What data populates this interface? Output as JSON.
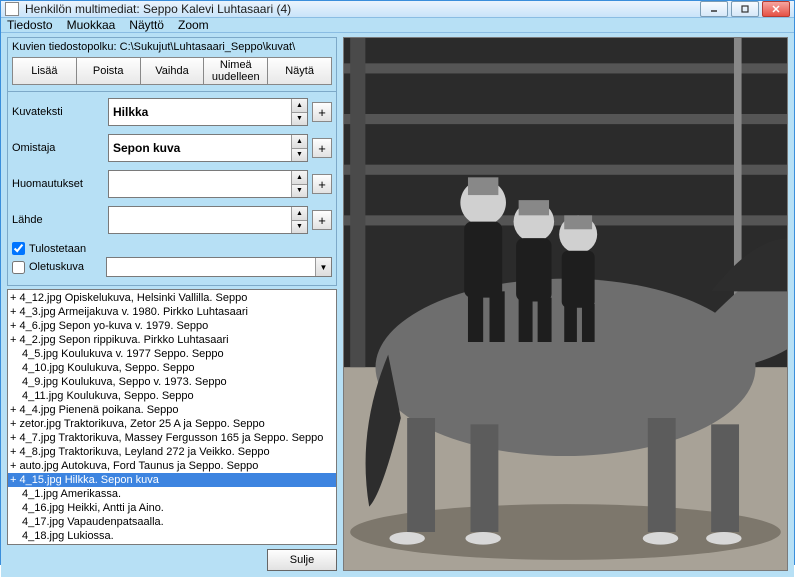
{
  "title": "Henkilön multimediat: Seppo Kalevi Luhtasaari (4)",
  "menu": {
    "tiedosto": "Tiedosto",
    "muokkaa": "Muokkaa",
    "naytto": "Näyttö",
    "zoom": "Zoom"
  },
  "pathlabel": "Kuvien tiedostopolku: C:\\Sukujut\\Luhtasaari_Seppo\\kuvat\\",
  "toolbar": {
    "lisaa": "Lisää",
    "poista": "Poista",
    "vaihda": "Vaihda",
    "nimea": "Nimeä\nuudelleen",
    "nayta": "Näytä"
  },
  "fields": {
    "kuvateksti_label": "Kuvateksti",
    "kuvateksti_value": "Hilkka",
    "omistaja_label": "Omistaja",
    "omistaja_value": "Sepon kuva",
    "huomautukset_label": "Huomautukset",
    "huomautukset_value": "",
    "lahde_label": "Lähde",
    "lahde_value": "",
    "tulostetaan": "Tulostetaan",
    "oletuskuva": "Oletuskuva"
  },
  "plus": "+",
  "files": [
    {
      "t": "+ 4_12.jpg Opiskelukuva, Helsinki Vallilla. Seppo",
      "i": false,
      "s": false
    },
    {
      "t": "+ 4_3.jpg Armeijakuva v. 1980. Pirkko Luhtasaari",
      "i": false,
      "s": false
    },
    {
      "t": "+ 4_6.jpg Sepon yo-kuva v. 1979. Seppo",
      "i": false,
      "s": false
    },
    {
      "t": "+ 4_2.jpg Sepon rippikuva. Pirkko Luhtasaari",
      "i": false,
      "s": false
    },
    {
      "t": "4_5.jpg Koulukuva v. 1977 Seppo. Seppo",
      "i": true,
      "s": false
    },
    {
      "t": "4_10.jpg Koulukuva, Seppo. Seppo",
      "i": true,
      "s": false
    },
    {
      "t": "4_9.jpg Koulukuva, Seppo v. 1973. Seppo",
      "i": true,
      "s": false
    },
    {
      "t": "4_11.jpg Koulukuva, Seppo. Seppo",
      "i": true,
      "s": false
    },
    {
      "t": "+ 4_4.jpg Pienenä poikana. Seppo",
      "i": false,
      "s": false
    },
    {
      "t": "+ zetor.jpg Traktorikuva, Zetor 25 A ja Seppo. Seppo",
      "i": false,
      "s": false
    },
    {
      "t": "+ 4_7.jpg Traktorikuva, Massey Fergusson 165 ja Seppo. Seppo",
      "i": false,
      "s": false
    },
    {
      "t": "+ 4_8.jpg Traktorikuva, Leyland 272 ja Veikko. Seppo",
      "i": false,
      "s": false
    },
    {
      "t": "+ auto.jpg Autokuva, Ford Taunus ja Seppo. Seppo",
      "i": false,
      "s": false
    },
    {
      "t": "+ 4_15.jpg Hilkka. Sepon kuva",
      "i": false,
      "s": true
    },
    {
      "t": "4_1.jpg Amerikassa.",
      "i": true,
      "s": false
    },
    {
      "t": "4_16.jpg Heikki, Antti ja Aino.",
      "i": true,
      "s": false
    },
    {
      "t": "4_17.jpg Vapaudenpatsaalla.",
      "i": true,
      "s": false
    },
    {
      "t": "4_18.jpg Lukiossa.",
      "i": true,
      "s": false
    }
  ],
  "close_btn": "Sulje"
}
